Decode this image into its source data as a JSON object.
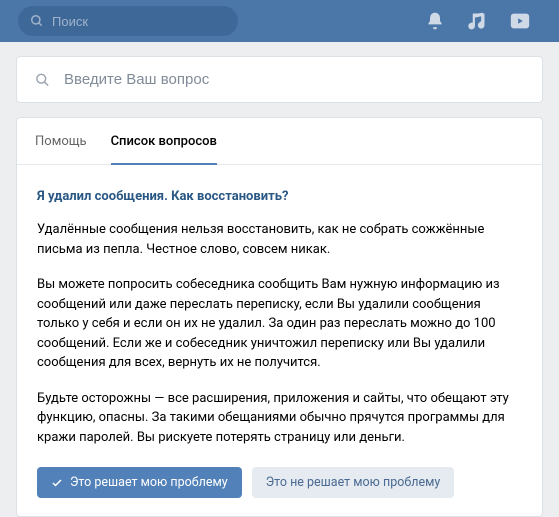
{
  "topbar": {
    "search_placeholder": "Поиск"
  },
  "question_search": {
    "placeholder": "Введите Ваш вопрос"
  },
  "tabs": [
    {
      "label": "Помощь"
    },
    {
      "label": "Список вопросов"
    }
  ],
  "article": {
    "title": "Я удалил сообщения. Как восстановить?",
    "paragraphs": [
      "Удалённые сообщения нельзя восстановить, как не собрать сожжённые письма из пепла. Честное слово, совсем никак.",
      "Вы можете попросить собеседника сообщить Вам нужную информацию из сообщений или даже переслать переписку, если Вы удалили сообщения только у себя и если он их не удалил. За один раз переслать можно до 100 сообщений. Если же и собеседник уничтожил переписку или Вы удалили сообщения для всех, вернуть их не получится.",
      "Будьте осторожны — все расширения, приложения и сайты, что обещают эту функцию, опасны. За такими обещаниями обычно прячутся программы для кражи паролей. Вы рискуете потерять страницу или деньги."
    ]
  },
  "actions": {
    "solves": "Это решает мою проблему",
    "not_solves": "Это не решает мою проблему"
  }
}
